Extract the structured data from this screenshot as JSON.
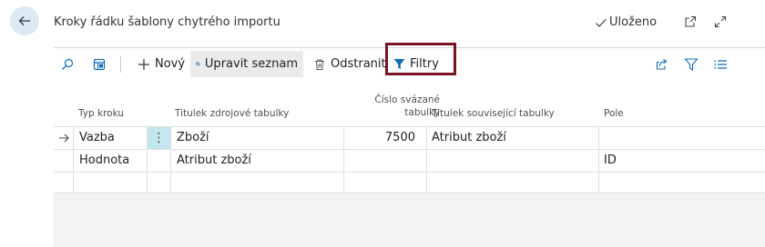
{
  "header": {
    "title": "Kroky řádku šablony chytrého importu",
    "status": "Uloženo"
  },
  "toolbar": {
    "new_label": "Nový",
    "edit_list_label": "Upravit seznam",
    "delete_label": "Odstranit",
    "filters_label": "Filtry"
  },
  "grid": {
    "columns": [
      "Typ kroku",
      "Titulek zdrojové tabulky",
      "Číslo svázané tabulky",
      "Titulek související tabulky",
      "Pole"
    ],
    "col_number_line1": "Číslo svázané",
    "col_number_line2": "tabulky",
    "rows": [
      {
        "step_type": "Vazba",
        "source_caption": "Zboží",
        "related_no": "7500",
        "related_caption": "Atribut zboží",
        "field": ""
      },
      {
        "step_type": "Hodnota",
        "source_caption": "Atribut zboží",
        "related_no": "",
        "related_caption": "",
        "field": "ID"
      },
      {
        "step_type": "",
        "source_caption": "",
        "related_no": "",
        "related_caption": "",
        "field": ""
      }
    ]
  },
  "colors": {
    "accent": "#0f6cbd",
    "highlight_border": "#7a1325",
    "selected_cell": "#c2e8ee",
    "back_button_bg": "#dde9f3"
  },
  "icons": {
    "back": "arrow-left-icon",
    "saved": "checkmark-icon",
    "open_new": "open-in-new-icon",
    "expand": "expand-icon",
    "search": "search-icon",
    "grid_view": "grid-view-icon",
    "add": "plus-icon",
    "edit_list": "edit-list-icon",
    "delete": "trash-icon",
    "filter": "filter-icon",
    "share": "share-icon",
    "filter_pane": "filter-pane-icon",
    "list": "list-icon",
    "row_arrow": "arrow-right-icon",
    "row_menu": "more-vertical-icon"
  }
}
